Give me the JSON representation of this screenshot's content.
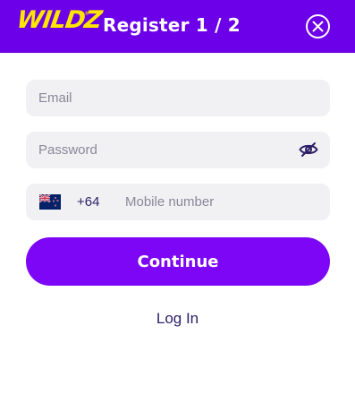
{
  "header": {
    "logo_text": "WILDZ",
    "logo_tm": "®",
    "title": "Register 1 / 2",
    "close_icon": "close-circle-icon",
    "bg_color": "#6c00e8",
    "logo_color": "#ffe600"
  },
  "form": {
    "email": {
      "placeholder": "Email",
      "value": ""
    },
    "password": {
      "placeholder": "Password",
      "value": "",
      "toggle_icon": "eye-hidden-icon"
    },
    "phone": {
      "flag_icon": "new-zealand-flag-icon",
      "dial_code": "+64",
      "placeholder": "Mobile number",
      "value": ""
    }
  },
  "actions": {
    "continue_label": "Continue",
    "continue_color": "#7c06f5",
    "login_label": "Log In"
  }
}
